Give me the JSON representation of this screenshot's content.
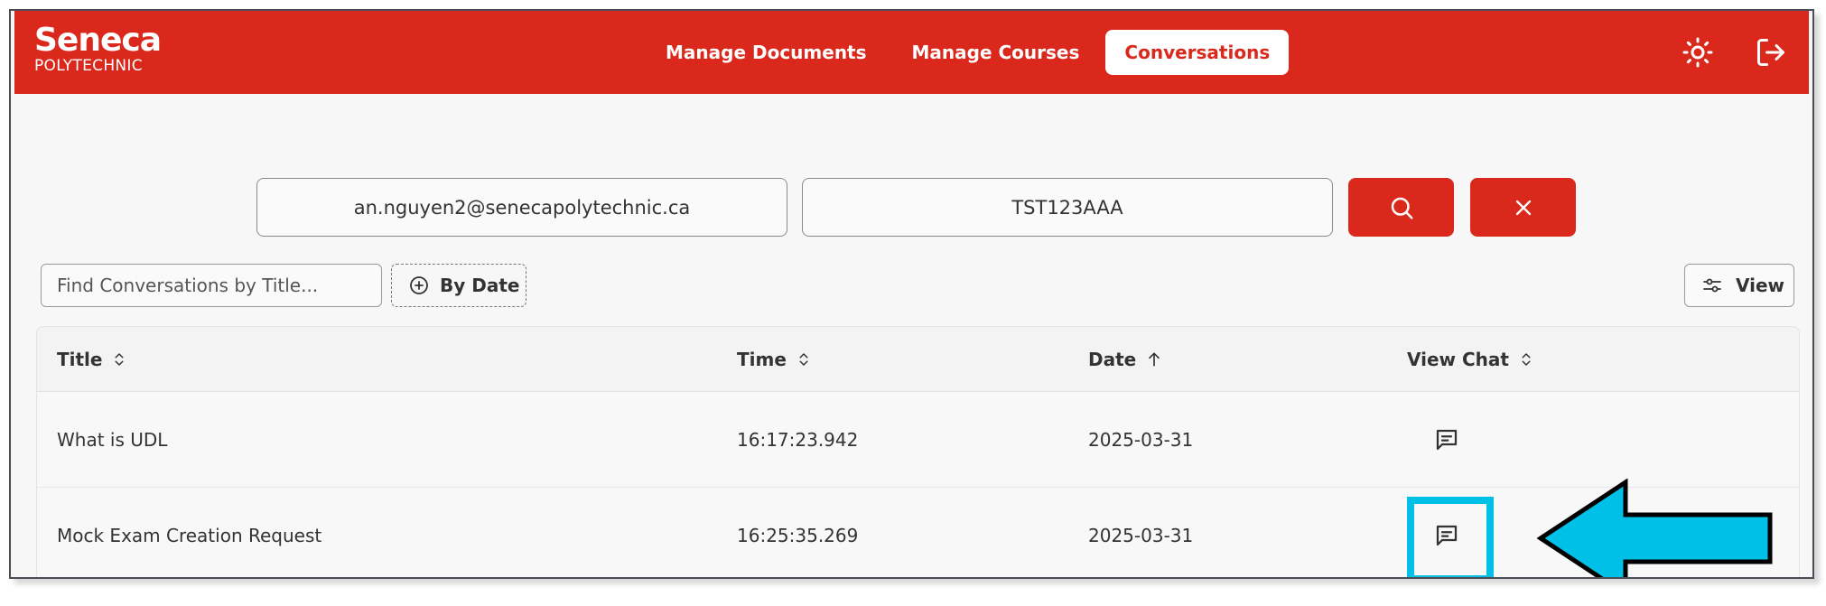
{
  "brand": {
    "name": "Seneca",
    "subtitle": "POLYTECHNIC"
  },
  "nav": {
    "items": [
      {
        "label": "Manage Documents",
        "active": false
      },
      {
        "label": "Manage Courses",
        "active": false
      },
      {
        "label": "Conversations",
        "active": true
      }
    ]
  },
  "header_icons": {
    "theme": "sun-icon",
    "logout": "logout-icon"
  },
  "search": {
    "email_value": "an.nguyen2@senecapolytechnic.ca",
    "course_value": "TST123AAA",
    "search_icon": "search-icon",
    "clear_icon": "close-icon"
  },
  "filters": {
    "title_placeholder": "Find Conversations by Title...",
    "by_date_label": "By Date",
    "view_label": "View"
  },
  "table": {
    "columns": [
      "Title",
      "Time",
      "Date",
      "View Chat"
    ],
    "sort": {
      "Title": "unsorted",
      "Time": "unsorted",
      "Date": "ascending",
      "View Chat": "unsorted"
    },
    "rows": [
      {
        "title": "What is UDL",
        "time": "16:17:23.942",
        "date": "2025-03-31"
      },
      {
        "title": "Mock Exam Creation Request",
        "time": "16:25:35.269",
        "date": "2025-03-31"
      }
    ]
  },
  "colors": {
    "brand_red": "#da291c",
    "highlight": "#00c0e8",
    "arrow": "#00c0e8"
  }
}
